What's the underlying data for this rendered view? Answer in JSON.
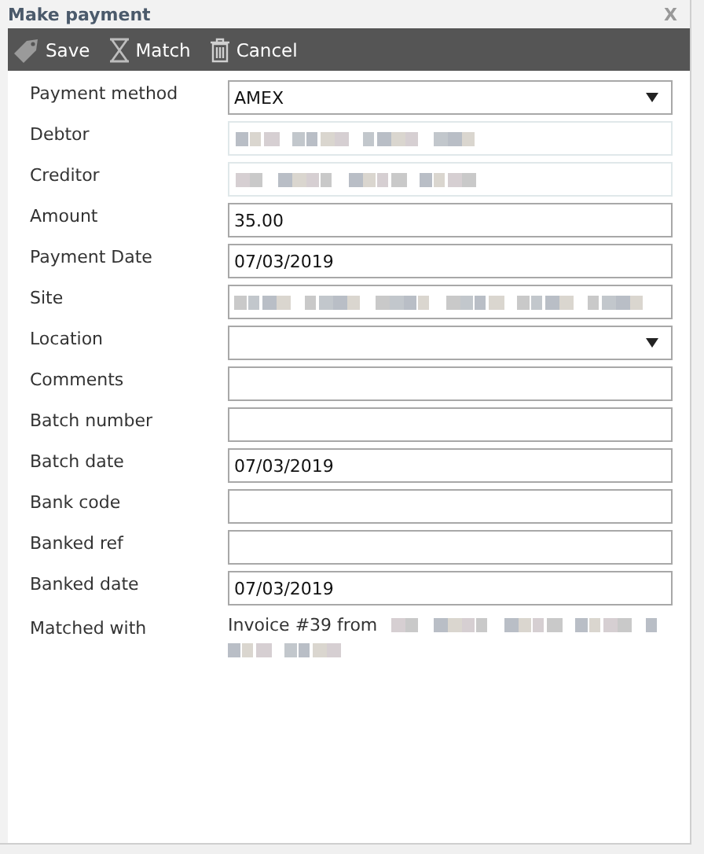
{
  "window": {
    "title": "Make payment",
    "close": "X"
  },
  "toolbar": [
    {
      "label": "Save",
      "kind": "save"
    },
    {
      "label": "Match",
      "kind": "match"
    },
    {
      "label": "Cancel",
      "kind": "cancel"
    }
  ],
  "fields": [
    {
      "label": "Payment method",
      "kind": "select",
      "value": "AMEX"
    },
    {
      "label": "Debtor",
      "kind": "redacted"
    },
    {
      "label": "Creditor",
      "kind": "redacted"
    },
    {
      "label": "Amount",
      "kind": "text",
      "value": "35.00"
    },
    {
      "label": "Payment Date",
      "kind": "text",
      "value": "07/03/2019"
    },
    {
      "label": "Site",
      "kind": "redacted_box"
    },
    {
      "label": "Location",
      "kind": "select"
    },
    {
      "label": "Comments",
      "kind": "text"
    },
    {
      "label": "Batch number",
      "kind": "text"
    },
    {
      "label": "Batch date",
      "kind": "text",
      "value": "07/03/2019"
    },
    {
      "label": "Bank code",
      "kind": "text"
    },
    {
      "label": "Banked ref",
      "kind": "text"
    },
    {
      "label": "Banked date",
      "kind": "text",
      "value": "07/03/2019"
    }
  ],
  "matched": {
    "label": "Matched with",
    "text": "Invoice #39 from"
  }
}
